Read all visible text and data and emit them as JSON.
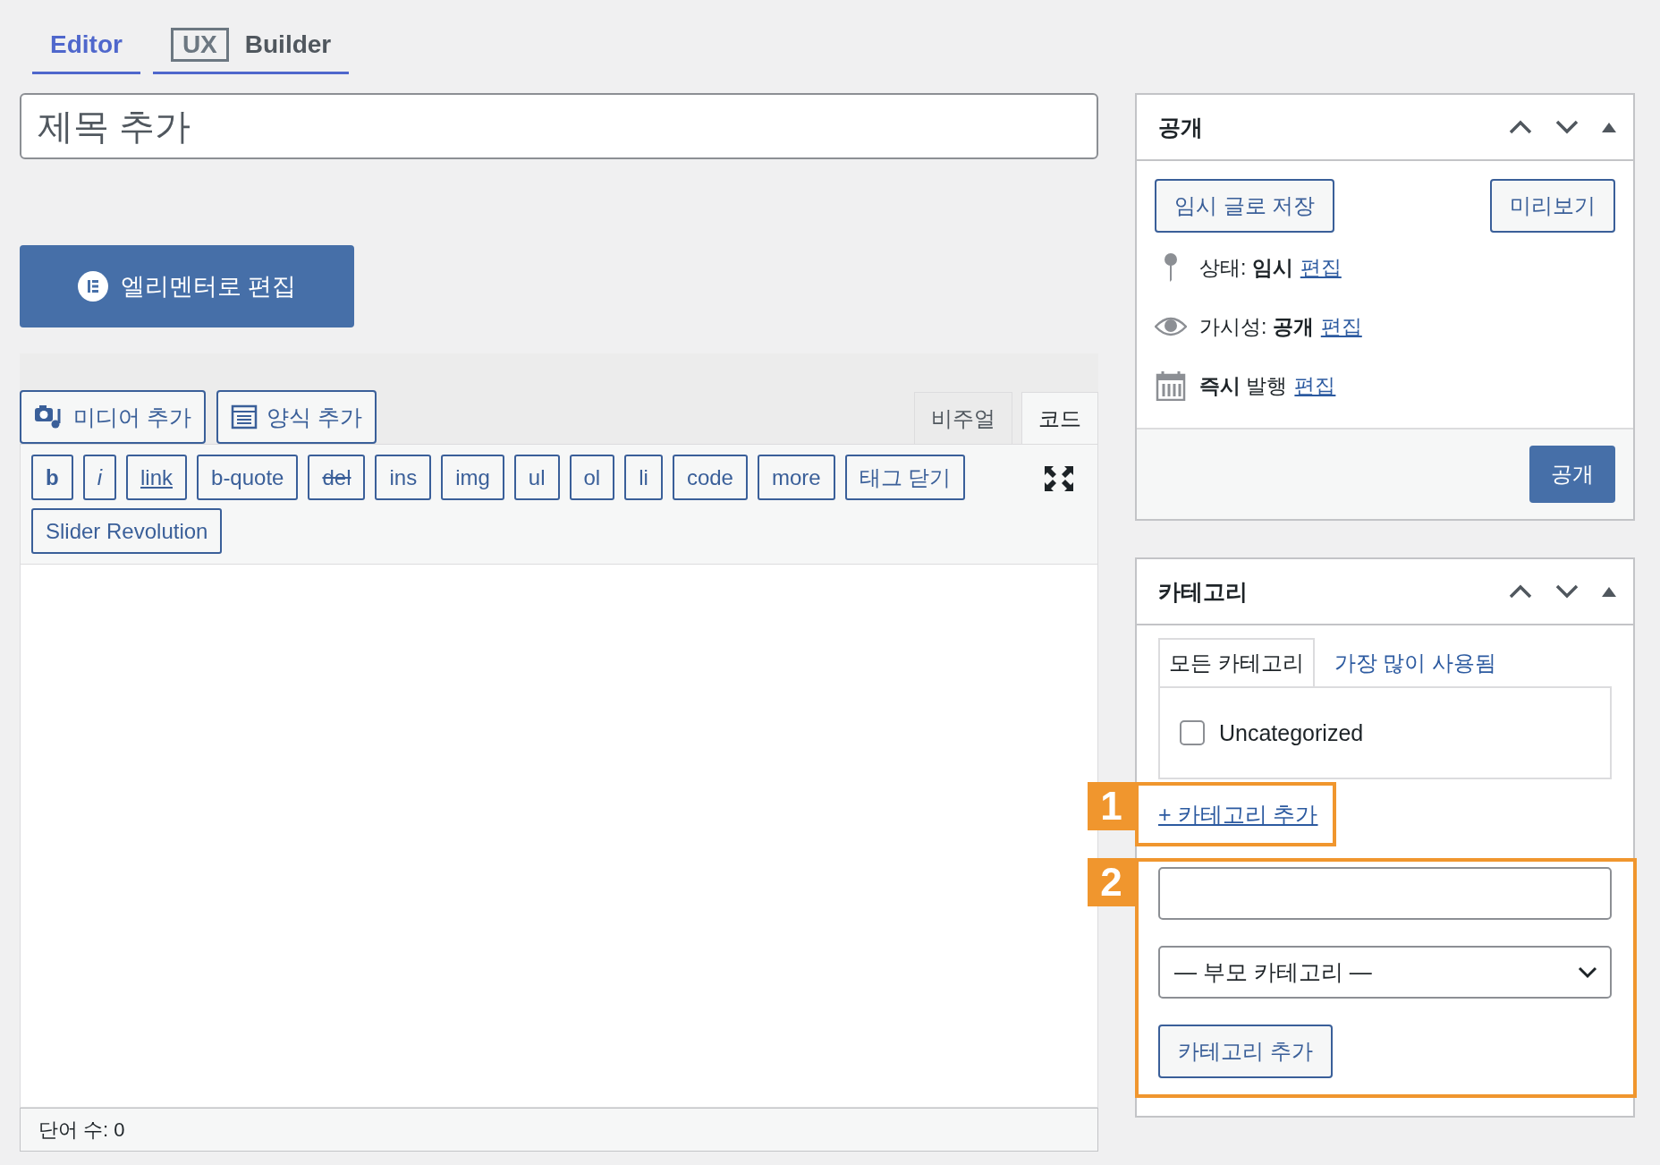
{
  "editor_tabs": [
    {
      "label": "Editor",
      "selected": true
    },
    {
      "badge": "UX",
      "label": "Builder",
      "selected": false
    }
  ],
  "title_field": {
    "placeholder": "제목 추가"
  },
  "elementor_button": "엘리멘터로 편집",
  "media_buttons": [
    {
      "kind": "media",
      "label": "미디어 추가"
    },
    {
      "kind": "form",
      "label": "양식 추가"
    }
  ],
  "editor_mode_tabs": [
    {
      "label": "비주얼",
      "selected": false
    },
    {
      "label": "코드",
      "selected": true
    }
  ],
  "quicktags": [
    {
      "label": "b",
      "kind": "bold"
    },
    {
      "label": "i",
      "kind": "italic"
    },
    {
      "label": "link",
      "kind": "link"
    },
    {
      "label": "b-quote",
      "kind": "plain"
    },
    {
      "label": "del",
      "kind": "strike"
    },
    {
      "label": "ins",
      "kind": "plain"
    },
    {
      "label": "img",
      "kind": "plain"
    },
    {
      "label": "ul",
      "kind": "plain"
    },
    {
      "label": "ol",
      "kind": "plain"
    },
    {
      "label": "li",
      "kind": "plain"
    },
    {
      "label": "code",
      "kind": "plain"
    },
    {
      "label": "more",
      "kind": "plain"
    },
    {
      "label": "태그 닫기",
      "kind": "plain"
    },
    {
      "label": "Slider Revolution",
      "kind": "plain"
    }
  ],
  "word_count": "단어 수: 0",
  "publish_box": {
    "title": "공개",
    "save_draft": "임시 글로 저장",
    "preview": "미리보기",
    "rows": [
      {
        "kind": "status",
        "text": "상태: **임시**",
        "link": "편집"
      },
      {
        "kind": "visibility",
        "text": "가시성: **공개**",
        "link": "편집"
      },
      {
        "kind": "schedule",
        "text": "**즉시** 발행",
        "link": "편집"
      }
    ],
    "publish_button": "공개"
  },
  "category_box": {
    "title": "카테고리",
    "tabs": [
      {
        "label": "모든 카테고리",
        "selected": true
      },
      {
        "label": "가장 많이 사용됨",
        "selected": false
      }
    ],
    "categories": [
      {
        "name": "Uncategorized",
        "checked": false
      }
    ],
    "add_link": "+ 카테고리 추가",
    "parent_select": "— 부모 카테고리 —",
    "add_button": "카테고리 추가"
  },
  "annotations": [
    {
      "number": "1"
    },
    {
      "number": "2"
    }
  ]
}
